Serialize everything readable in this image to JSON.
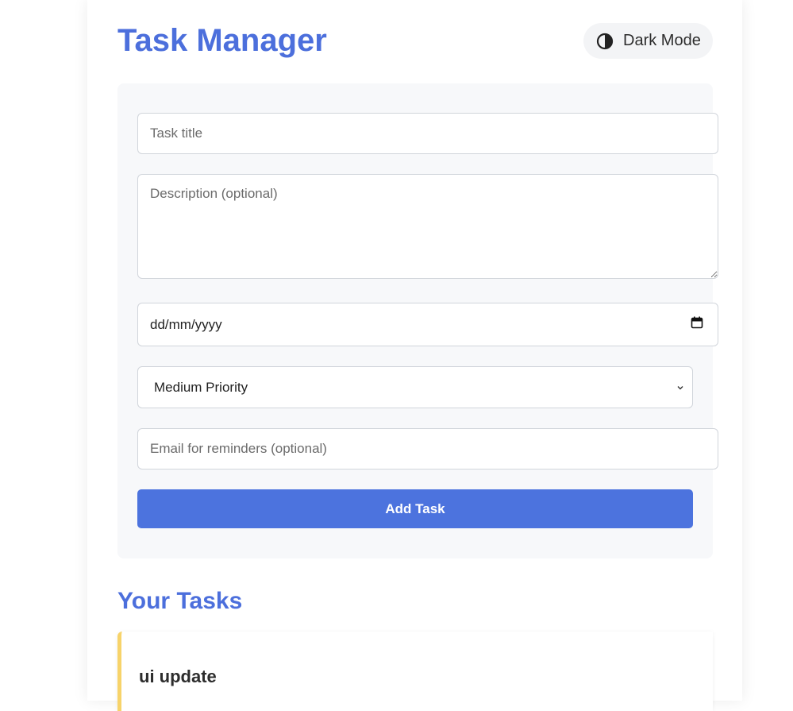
{
  "app": {
    "title": "Task Manager"
  },
  "theme_toggle": {
    "label": "Dark Mode",
    "icon": "half-circle-contrast-icon"
  },
  "form": {
    "title_placeholder": "Task title",
    "description_placeholder": "Description (optional)",
    "date_placeholder": "dd/mm/yyyy",
    "priority_selected": "Medium Priority",
    "email_placeholder": "Email for reminders (optional)",
    "submit_label": "Add Task"
  },
  "tasks_section": {
    "title": "Your Tasks",
    "items": [
      {
        "name": "ui update",
        "priority_color": "#f7d36a"
      }
    ]
  },
  "colors": {
    "accent": "#4c6fdc",
    "button": "#4c73de"
  }
}
